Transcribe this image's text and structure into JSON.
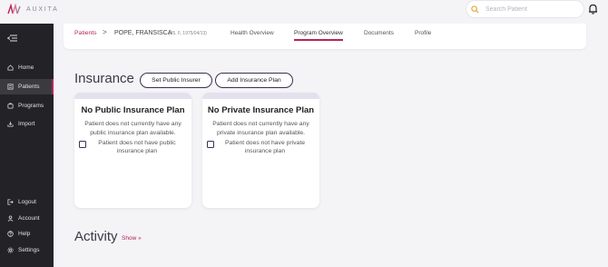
{
  "app": {
    "logo_text": "AUXITA"
  },
  "search": {
    "placeholder": "Search Patient"
  },
  "sidebar": {
    "items": [
      {
        "label": "Home"
      },
      {
        "label": "Patients"
      },
      {
        "label": "Programs"
      },
      {
        "label": "Import"
      },
      {
        "label": "Logout"
      },
      {
        "label": "Account"
      },
      {
        "label": "Help"
      },
      {
        "label": "Settings"
      }
    ]
  },
  "breadcrumb": {
    "root": "Patients",
    "separator": ">",
    "patient_name": "POPE, FRANSISCA",
    "patient_meta": "(45, F, 1975/04/13)"
  },
  "tabs": [
    {
      "label": "Health Overview"
    },
    {
      "label": "Program Overview"
    },
    {
      "label": "Documents"
    },
    {
      "label": "Profile"
    }
  ],
  "insurance": {
    "title": "Insurance",
    "set_public_label": "Set Public Insurer",
    "add_plan_label": "Add Insurance Plan",
    "public_card": {
      "title": "No Public Insurance Plan",
      "message": "Patient does not currently have any public insurance plan available.",
      "checkbox_label": "Patient does not have public insurance plan"
    },
    "private_card": {
      "title": "No Private Insurance Plan",
      "message": "Patient does not currently have any private insurance plan available.",
      "checkbox_label": "Patient does not have private insurance plan"
    }
  },
  "activity": {
    "title": "Activity",
    "show_label": "Show »"
  },
  "colors": {
    "accent": "#b3265a",
    "sidebar": "#232226",
    "button_border": "#3e2f52"
  }
}
